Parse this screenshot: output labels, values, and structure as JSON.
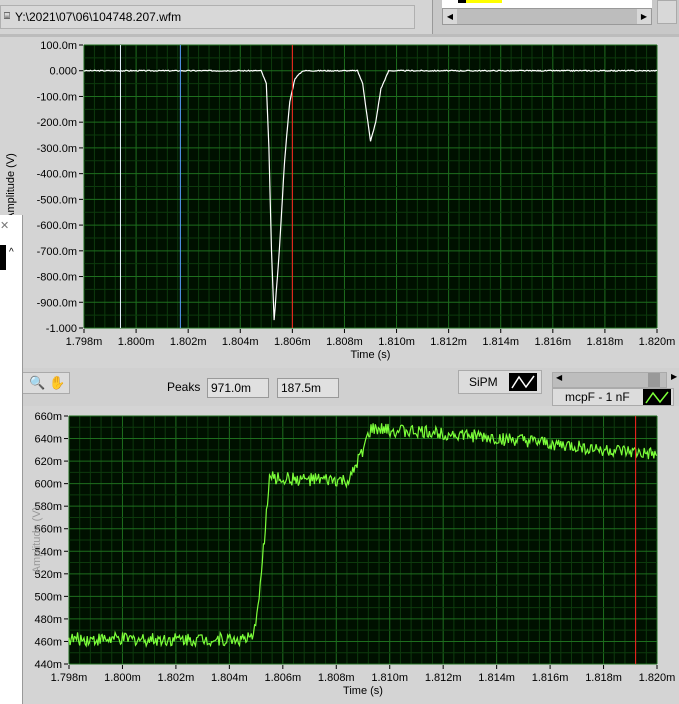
{
  "file_path": "Y:\\2021\\07\\06\\104748.207.wfm",
  "colors": {
    "plot_bg": "#001000",
    "grid": "#1e6e1e",
    "top_trace": "#ffffff",
    "bottom_trace": "#7cff3a",
    "cursor_red": "#ff2020",
    "cursor_white": "#e8f4ff",
    "cursor_blue": "#5aa0ff"
  },
  "toolbar": {
    "zoom_icon": "zoom-icon",
    "pan_icon": "hand-icon",
    "peaks_label": "Peaks",
    "peak1": "971.0m",
    "peak2": "187.5m"
  },
  "legend": {
    "sipm_label": "SiPM",
    "mcp_label": "mcpF - 1 nF"
  },
  "chart_data": [
    {
      "type": "line",
      "name": "top",
      "xlabel": "Time (s)",
      "ylabel": "Amplitude (V)",
      "xlim": [
        1.798,
        1.82
      ],
      "ylim": [
        -1.0,
        0.1
      ],
      "xticks": [
        "1.798m",
        "1.800m",
        "1.802m",
        "1.804m",
        "1.806m",
        "1.808m",
        "1.810m",
        "1.812m",
        "1.814m",
        "1.816m",
        "1.818m",
        "1.820m"
      ],
      "yticks": [
        "100.0m",
        "0.000",
        "-100.0m",
        "-200.0m",
        "-300.0m",
        "-400.0m",
        "-500.0m",
        "-600.0m",
        "-700.0m",
        "-800.0m",
        "-900.0m",
        "-1.000"
      ],
      "cursors_ms": [
        {
          "x": 1.7994,
          "color": "white"
        },
        {
          "x": 1.8017,
          "color": "blue"
        },
        {
          "x": 1.806,
          "color": "red"
        }
      ],
      "series": [
        {
          "name": "SiPM",
          "x": [
            1.798,
            1.8048,
            1.805,
            1.8051,
            1.8052,
            1.8053,
            1.8055,
            1.8057,
            1.8059,
            1.8061,
            1.8064,
            1.8085,
            1.8087,
            1.8089,
            1.809,
            1.8092,
            1.8094,
            1.8097,
            1.82
          ],
          "y": [
            0,
            0,
            -0.05,
            -0.3,
            -0.7,
            -0.971,
            -0.7,
            -0.35,
            -0.12,
            -0.03,
            0,
            0,
            -0.05,
            -0.2,
            -0.275,
            -0.2,
            -0.07,
            0,
            0
          ]
        }
      ]
    },
    {
      "type": "line",
      "name": "bottom",
      "xlabel": "Time (s)",
      "ylabel": "Amplitude (V)",
      "xlim": [
        1.798,
        1.82
      ],
      "ylim": [
        0.44,
        0.66
      ],
      "xticks": [
        "1.798m",
        "1.800m",
        "1.802m",
        "1.804m",
        "1.806m",
        "1.808m",
        "1.810m",
        "1.812m",
        "1.814m",
        "1.816m",
        "1.818m",
        "1.820m"
      ],
      "yticks": [
        "660m",
        "640m",
        "620m",
        "600m",
        "580m",
        "560m",
        "540m",
        "520m",
        "500m",
        "480m",
        "460m",
        "440m"
      ],
      "cursors_ms": [
        {
          "x": 1.8192,
          "color": "red"
        }
      ],
      "series": [
        {
          "name": "mcpF - 1 nF",
          "x": [
            1.798,
            1.8049,
            1.8052,
            1.8055,
            1.8085,
            1.8089,
            1.8093,
            1.812,
            1.816,
            1.82
          ],
          "y": [
            0.462,
            0.462,
            0.52,
            0.605,
            0.602,
            0.625,
            0.648,
            0.645,
            0.635,
            0.625
          ]
        }
      ]
    }
  ]
}
